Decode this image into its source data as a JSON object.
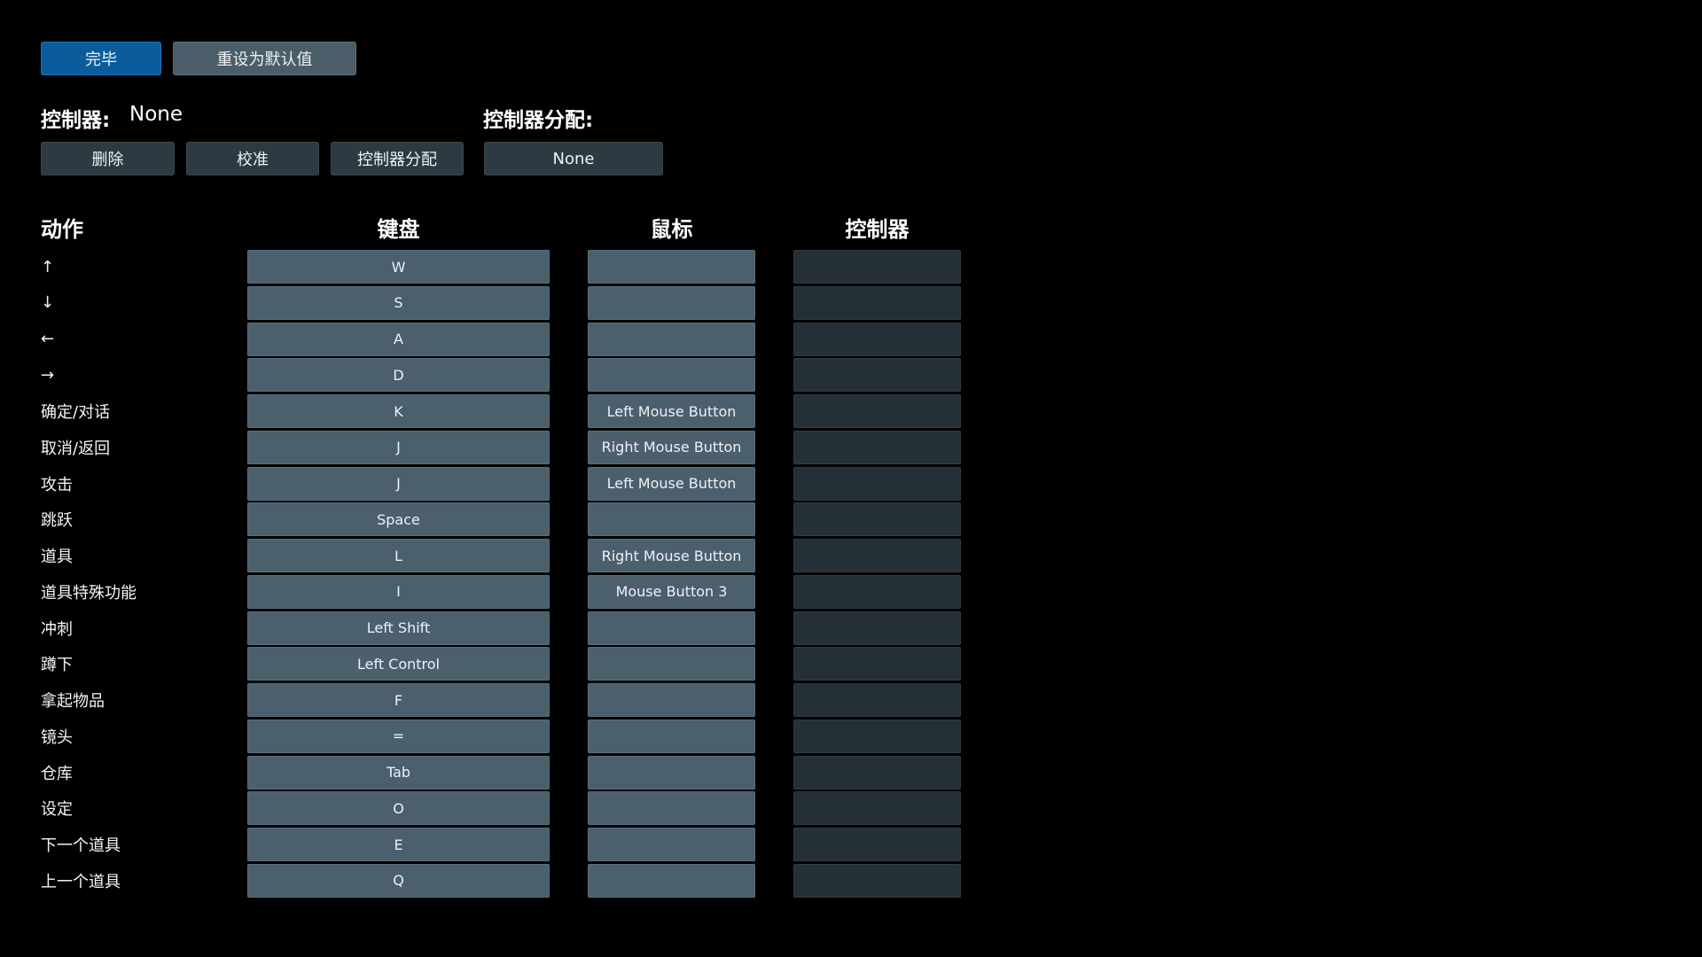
{
  "top_buttons": {
    "done": "完毕",
    "reset": "重设为默认值"
  },
  "controller": {
    "label": "控制器:",
    "value": "None",
    "delete_label": "删除",
    "calibrate_label": "校准",
    "assign_label": "控制器分配"
  },
  "controller_assignment": {
    "label": "控制器分配:",
    "value": "None"
  },
  "columns": {
    "action": "动作",
    "keyboard": "键盘",
    "mouse": "鼠标",
    "controller": "控制器"
  },
  "bindings": [
    {
      "action": "↑",
      "keyboard": "W",
      "mouse": "",
      "controller": ""
    },
    {
      "action": "↓",
      "keyboard": "S",
      "mouse": "",
      "controller": ""
    },
    {
      "action": "←",
      "keyboard": "A",
      "mouse": "",
      "controller": ""
    },
    {
      "action": "→",
      "keyboard": "D",
      "mouse": "",
      "controller": ""
    },
    {
      "action": "确定/对话",
      "keyboard": "K",
      "mouse": "Left Mouse Button",
      "controller": ""
    },
    {
      "action": "取消/返回",
      "keyboard": "J",
      "mouse": "Right Mouse Button",
      "controller": ""
    },
    {
      "action": "攻击",
      "keyboard": "J",
      "mouse": "Left Mouse Button",
      "controller": ""
    },
    {
      "action": "跳跃",
      "keyboard": "Space",
      "mouse": "",
      "controller": ""
    },
    {
      "action": "道具",
      "keyboard": "L",
      "mouse": "Right Mouse Button",
      "controller": ""
    },
    {
      "action": "道具特殊功能",
      "keyboard": "I",
      "mouse": "Mouse Button 3",
      "controller": ""
    },
    {
      "action": "冲刺",
      "keyboard": "Left Shift",
      "mouse": "",
      "controller": ""
    },
    {
      "action": "蹲下",
      "keyboard": "Left Control",
      "mouse": "",
      "controller": ""
    },
    {
      "action": "拿起物品",
      "keyboard": "F",
      "mouse": "",
      "controller": ""
    },
    {
      "action": "镜头",
      "keyboard": "=",
      "mouse": "",
      "controller": ""
    },
    {
      "action": "仓库",
      "keyboard": "Tab",
      "mouse": "",
      "controller": ""
    },
    {
      "action": "设定",
      "keyboard": "O",
      "mouse": "",
      "controller": ""
    },
    {
      "action": "下一个道具",
      "keyboard": "E",
      "mouse": "",
      "controller": ""
    },
    {
      "action": "上一个道具",
      "keyboard": "Q",
      "mouse": "",
      "controller": ""
    }
  ]
}
